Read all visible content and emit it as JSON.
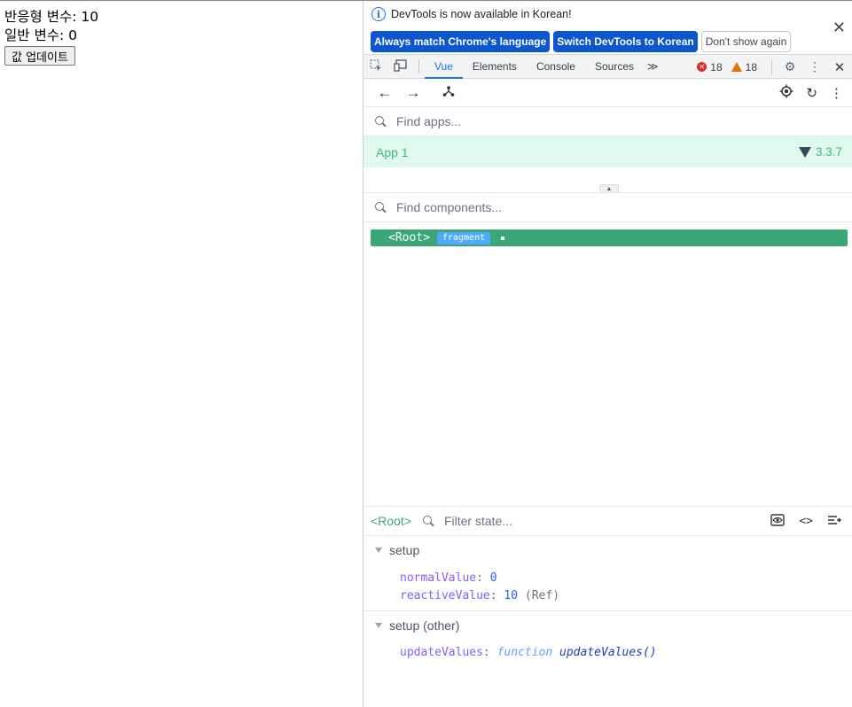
{
  "page": {
    "reactive_line": "반응형 변수: 10",
    "normal_line": "일반 변수: 0",
    "update_button": "값 업데이트"
  },
  "infobar": {
    "message": "DevTools is now available in Korean!",
    "btn_match": "Always match Chrome's language",
    "btn_switch": "Switch DevTools to Korean",
    "btn_dont_show": "Don't show again",
    "close": "✕"
  },
  "tabs": {
    "items": [
      "Vue",
      "Elements",
      "Console",
      "Sources"
    ],
    "more": "≫",
    "errors": "18",
    "warnings": "18"
  },
  "vue": {
    "find_apps_placeholder": "Find apps...",
    "app_name": "App 1",
    "app_version": "3.3.7",
    "find_components_placeholder": "Find components...",
    "root_tag": "<Root>",
    "root_badge": "fragment",
    "selected_component": "<Root>",
    "filter_state_placeholder": "Filter state..."
  },
  "state": {
    "setup_title": "setup",
    "setup_items": [
      {
        "key": "normalValue",
        "value": "0",
        "note": ""
      },
      {
        "key": "reactiveValue",
        "value": "10",
        "note": "(Ref)"
      }
    ],
    "other_title": "setup (other)",
    "other_item": {
      "key": "updateValues",
      "kind": "function",
      "sig": "updateValues()"
    }
  },
  "colors": {
    "vue_green": "#42b883",
    "selected_row": "#3ba776",
    "badge_blue": "#4fa9ff",
    "chrome_blue": "#0b57d0"
  }
}
